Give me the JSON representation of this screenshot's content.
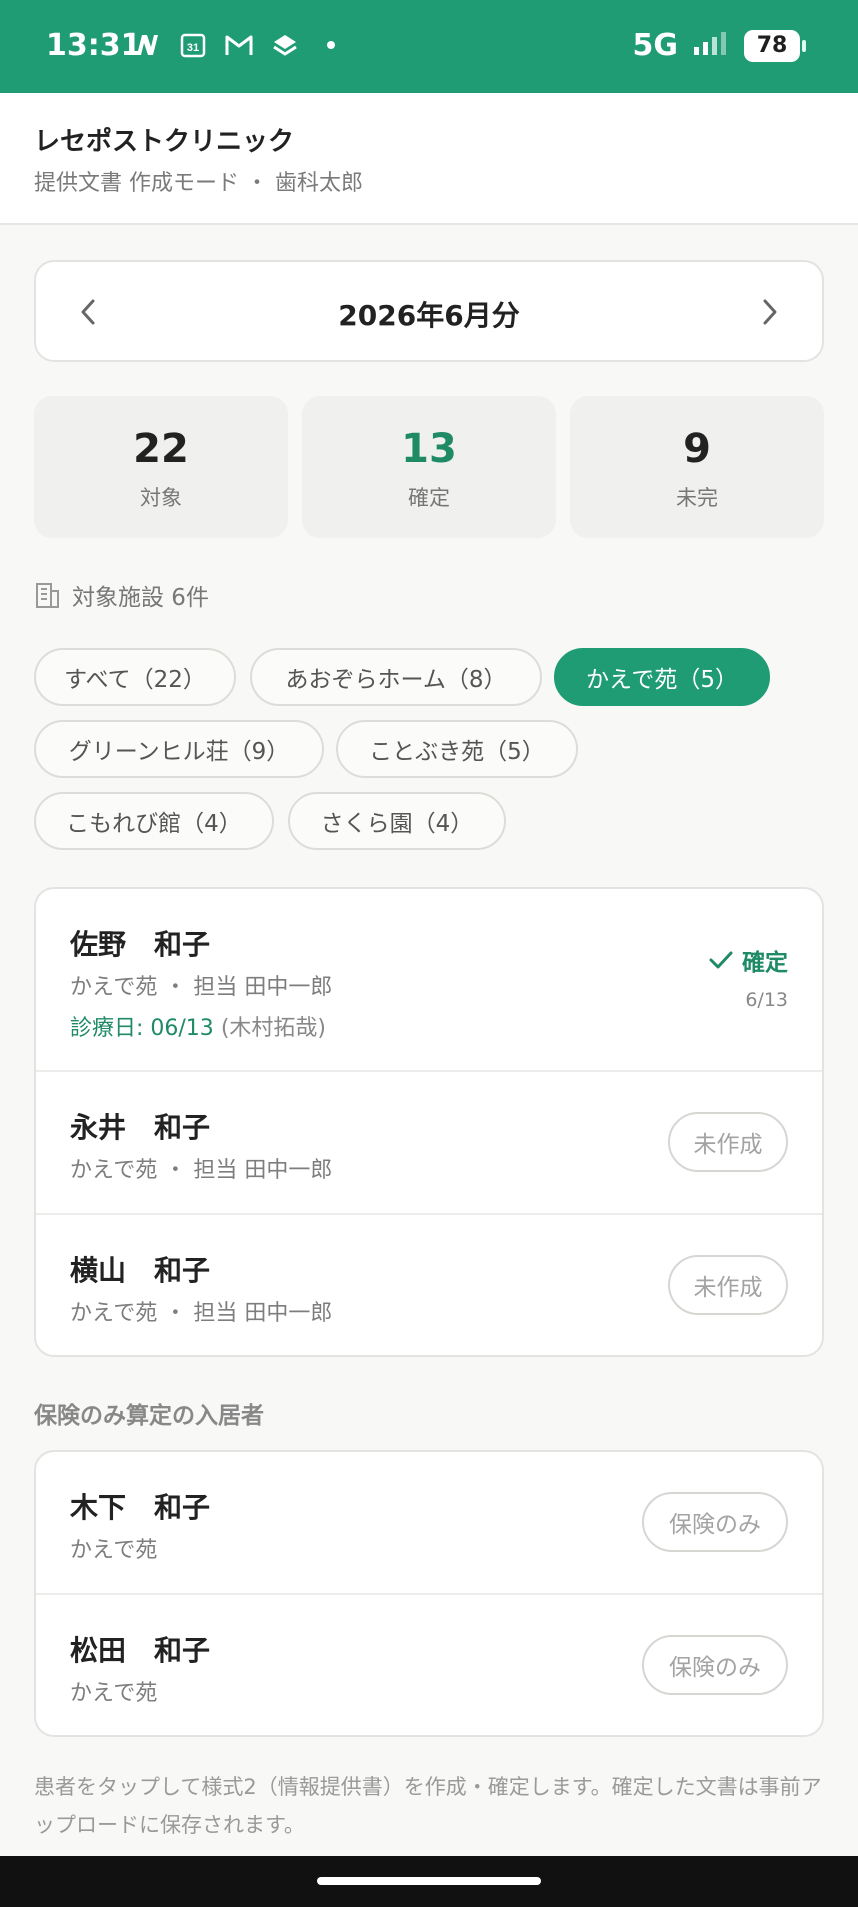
{
  "status_bar": {
    "time": "13:31",
    "network": "5G",
    "battery": "78",
    "icons": [
      "n-icon",
      "calendar-icon",
      "gmail-icon",
      "stack-icon",
      "dot-icon"
    ],
    "calendar_day": "31"
  },
  "header": {
    "title": "レセポストクリニック",
    "subtitle": "提供文書 作成モード ・ 歯科太郎"
  },
  "month_selector": {
    "label": "2026年6月分"
  },
  "stats": {
    "target": {
      "value": "22",
      "label": "対象"
    },
    "confirmed": {
      "value": "13",
      "label": "確定"
    },
    "incomplete": {
      "value": "9",
      "label": "未完"
    }
  },
  "facility_count": "対象施設 6件",
  "filters": [
    {
      "label": "すべて（22）",
      "active": false
    },
    {
      "label": "あおぞらホーム（8）",
      "active": false
    },
    {
      "label": "かえで苑（5）",
      "active": true
    },
    {
      "label": "グリーンヒル荘（9）",
      "active": false
    },
    {
      "label": "ことぶき苑（5）",
      "active": false
    },
    {
      "label": "こもれび館（4）",
      "active": false
    },
    {
      "label": "さくら園（4）",
      "active": false
    }
  ],
  "patients": [
    {
      "name": "佐野　和子",
      "sub": "かえで苑 ・ 担当 田中一郎",
      "date_label": "診療日: 06/13",
      "doctor": "(木村拓哉)",
      "status": "確定",
      "status_date": "6/13"
    },
    {
      "name": "永井　和子",
      "sub": "かえで苑 ・ 担当 田中一郎",
      "status": "未作成"
    },
    {
      "name": "横山　和子",
      "sub": "かえで苑 ・ 担当 田中一郎",
      "status": "未作成"
    }
  ],
  "insurance_section": {
    "title": "保険のみ算定の入居者",
    "patients": [
      {
        "name": "木下　和子",
        "sub": "かえで苑",
        "status": "保険のみ"
      },
      {
        "name": "松田　和子",
        "sub": "かえで苑",
        "status": "保険のみ"
      }
    ]
  },
  "footer_note": "患者をタップして様式2（情報提供書）を作成・確定します。確定した文書は事前アップロードに保存されます。",
  "colors": {
    "accent": "#1f9c74",
    "confirmed_text": "#1f8a66"
  }
}
